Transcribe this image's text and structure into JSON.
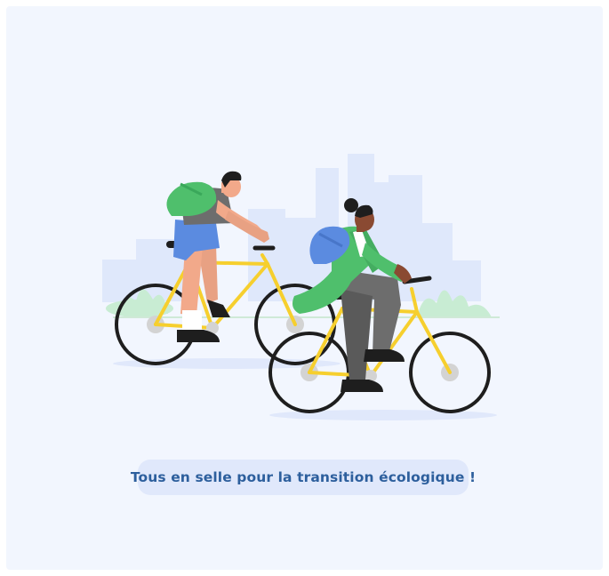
{
  "caption": {
    "text": "Tous en selle pour la transition écologique !"
  },
  "illustration": {
    "subject": "two-cyclists-on-yellow-bicycles",
    "colors": {
      "background": "#f2f6fe",
      "city_silhouette": "#dfe8fb",
      "bike_frame": "#f6cf2e",
      "tire": "#1e1e1e",
      "hub": "#d3d3d3",
      "backpack_green": "#4fbf6c",
      "backpack_blue": "#5b8be0",
      "shorts_blue": "#5b8be0",
      "jacket_green": "#4fbf6c",
      "pants_gray": "#6d6d6d",
      "skin_light": "#f2a98a",
      "skin_dark": "#8a4a32",
      "bush": "#c8ecd3",
      "caption_pill": "#e0e8fb",
      "caption_text": "#2d5f9d"
    }
  }
}
